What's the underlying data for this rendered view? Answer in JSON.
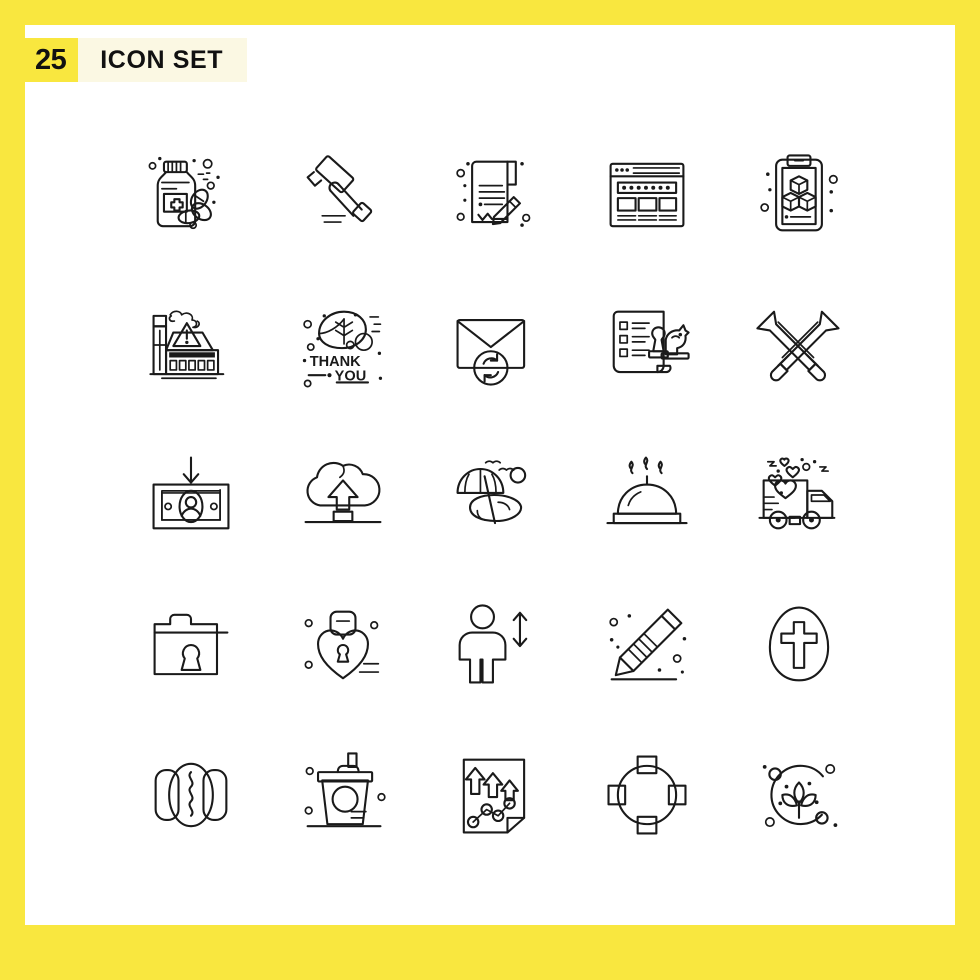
{
  "header": {
    "count": "25",
    "title": "ICON SET"
  },
  "colors": {
    "accent": "#f9e73f",
    "header_background": "#fbf8e3",
    "icon_stroke": "#1a1a1a",
    "canvas": "#ffffff"
  },
  "grid": {
    "columns": 5,
    "rows": 5,
    "total": 25
  },
  "icons": [
    {
      "name": "medicine-bottle-pills-icon",
      "row": 1,
      "col": 1
    },
    {
      "name": "gavel-hammer-icon",
      "row": 1,
      "col": 2
    },
    {
      "name": "contract-signature-icon",
      "row": 1,
      "col": 3
    },
    {
      "name": "web-page-layout-icon",
      "row": 1,
      "col": 4
    },
    {
      "name": "mobile-augmented-reality-cubes-icon",
      "row": 1,
      "col": 5
    },
    {
      "name": "factory-pollution-warning-icon",
      "row": 2,
      "col": 1
    },
    {
      "name": "thank-you-leaf-icon",
      "row": 2,
      "col": 2
    },
    {
      "name": "email-sync-icon",
      "row": 2,
      "col": 3
    },
    {
      "name": "strategy-checklist-chess-icon",
      "row": 2,
      "col": 4
    },
    {
      "name": "crossed-swords-icon",
      "row": 2,
      "col": 5
    },
    {
      "name": "money-income-icon",
      "row": 3,
      "col": 1
    },
    {
      "name": "cloud-upload-icon",
      "row": 3,
      "col": 2
    },
    {
      "name": "beach-umbrella-icon",
      "row": 3,
      "col": 3
    },
    {
      "name": "food-serving-dome-icon",
      "row": 3,
      "col": 4
    },
    {
      "name": "love-delivery-truck-icon",
      "row": 3,
      "col": 5
    },
    {
      "name": "locked-folder-icon",
      "row": 4,
      "col": 1
    },
    {
      "name": "heart-padlock-icon",
      "row": 4,
      "col": 2
    },
    {
      "name": "person-height-measure-icon",
      "row": 4,
      "col": 3
    },
    {
      "name": "pencil-edit-icon",
      "row": 4,
      "col": 4
    },
    {
      "name": "easter-egg-cross-icon",
      "row": 4,
      "col": 5
    },
    {
      "name": "hot-dog-icon",
      "row": 5,
      "col": 1
    },
    {
      "name": "soda-cup-straw-icon",
      "row": 5,
      "col": 2
    },
    {
      "name": "growth-report-document-icon",
      "row": 5,
      "col": 3
    },
    {
      "name": "transform-nodes-circle-icon",
      "row": 5,
      "col": 4
    },
    {
      "name": "eco-plant-circle-icon",
      "row": 5,
      "col": 5
    }
  ],
  "icon_text": {
    "thank_you_line1": "THANK",
    "thank_you_line2": "YOU"
  }
}
